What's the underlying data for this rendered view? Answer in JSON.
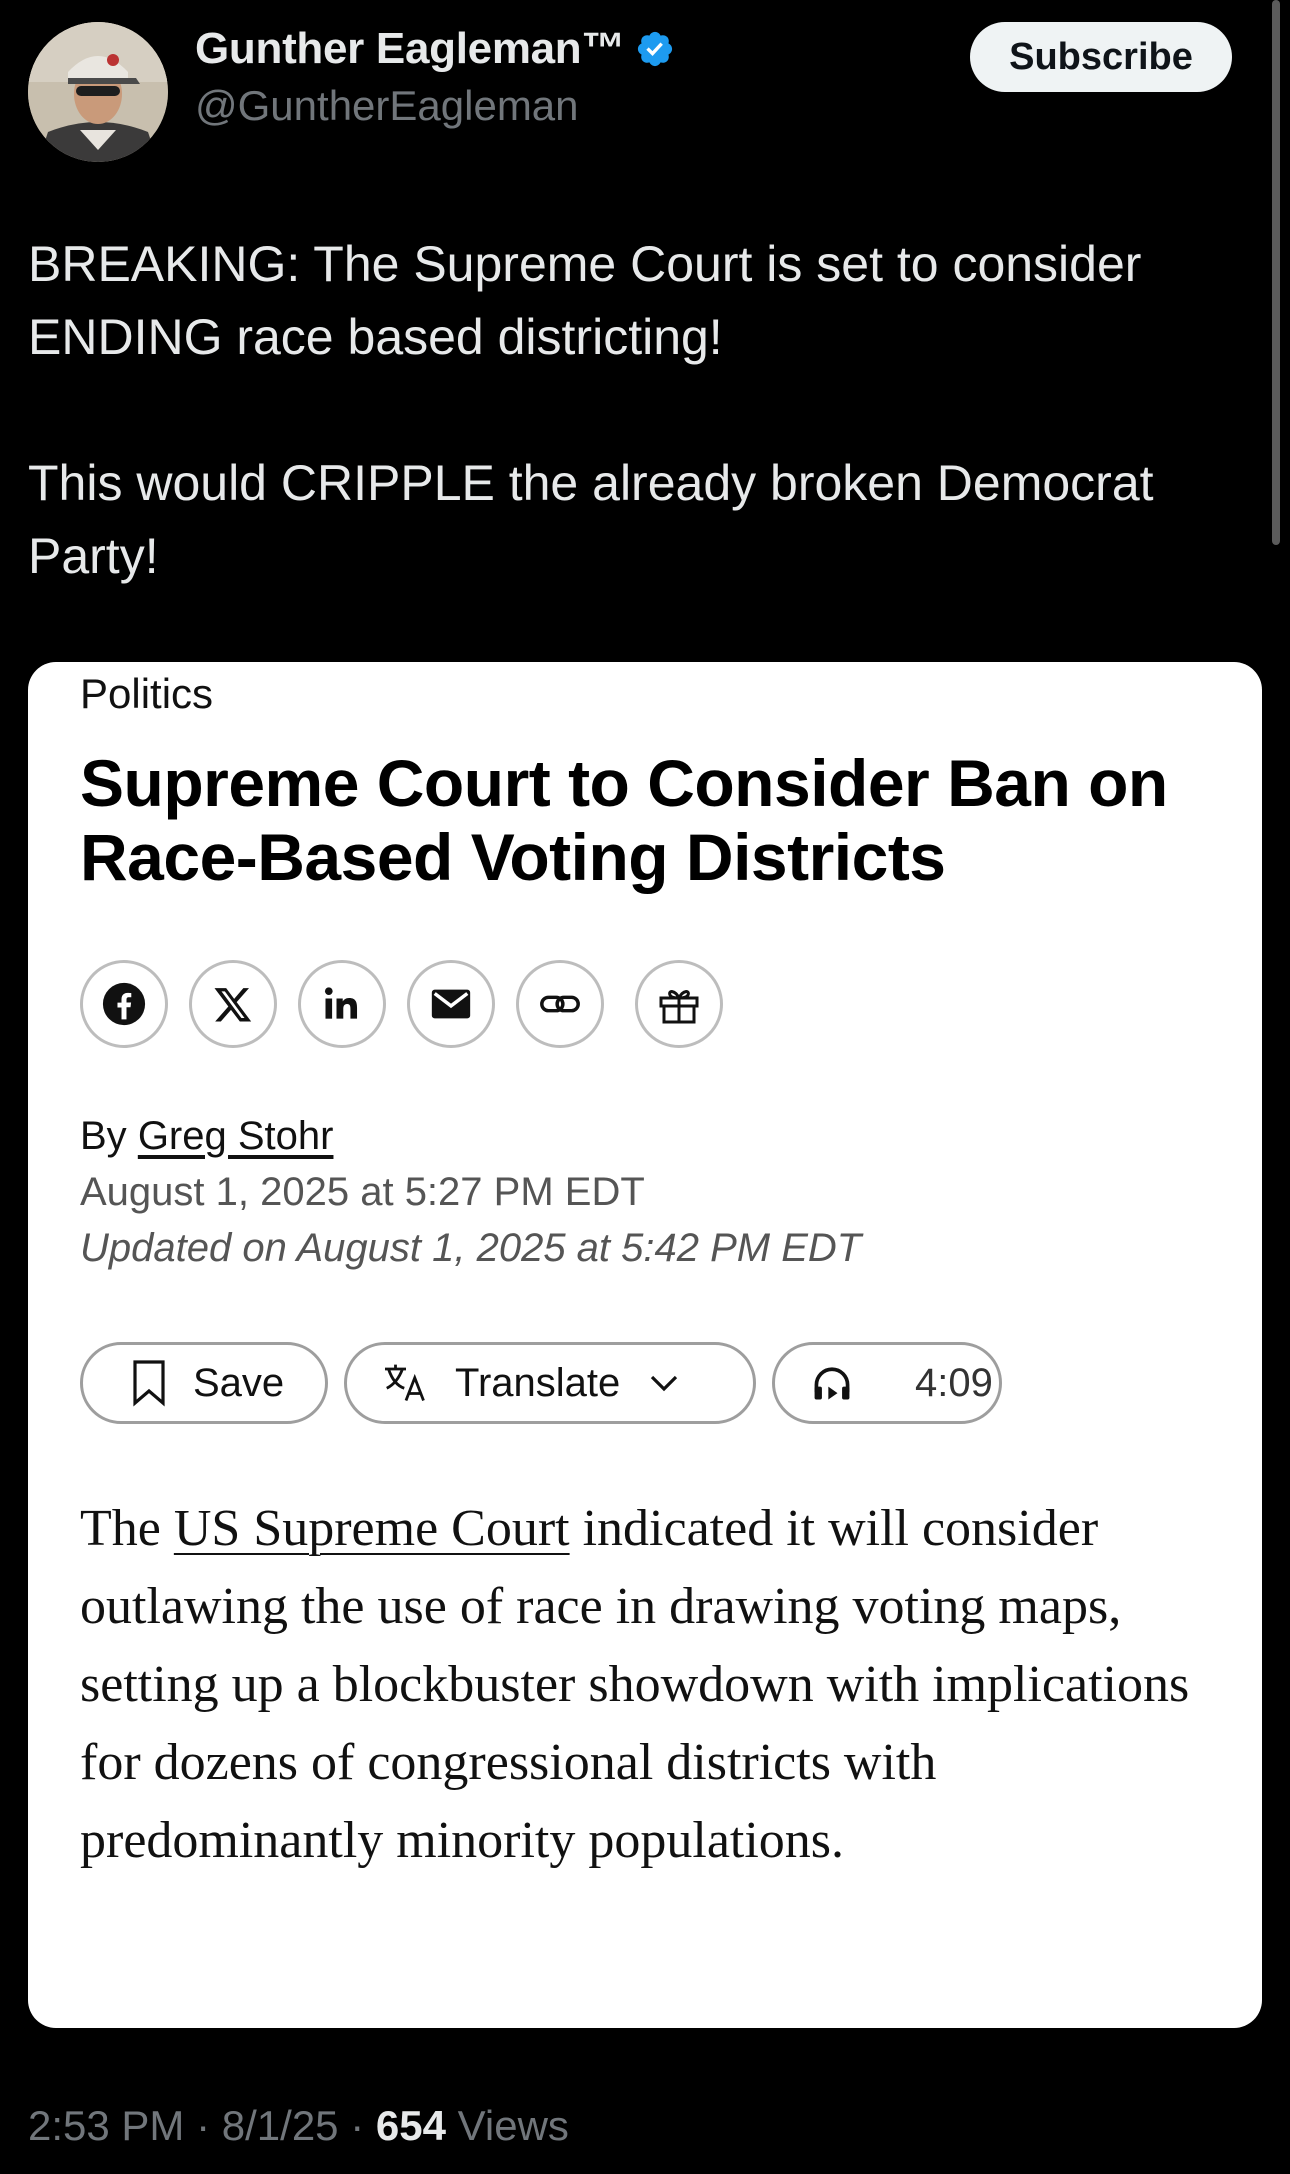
{
  "author": {
    "display_name": "Gunther Eagleman™",
    "handle": "@GuntherEagleman",
    "verified": true,
    "subscribe_label": "Subscribe"
  },
  "tweet": {
    "paragraphs": [
      "BREAKING: The Supreme Court is set to consider ENDING race based districting!",
      "This would CRIPPLE the already broken Democrat Party!"
    ]
  },
  "article": {
    "category": "Politics",
    "headline": "Supreme Court to Consider Ban on Race-Based Voting Districts",
    "share_icons": [
      "facebook-icon",
      "x-icon",
      "linkedin-icon",
      "email-icon",
      "link-icon",
      "gift-icon"
    ],
    "byline_prefix": "By",
    "author_name": "Greg Stohr",
    "published": "August 1, 2025 at 5:27 PM EDT",
    "updated": "Updated on August 1, 2025 at 5:42 PM EDT",
    "actions": {
      "save_label": "Save",
      "translate_label": "Translate",
      "audio_duration": "4:09"
    },
    "body_prefix": "The",
    "body_link": "US Supreme Court",
    "body_rest": "indicated it will consider outlawing the use of race in drawing voting maps, setting up a blockbuster showdown with implications for dozens of congressional districts with predominantly minority populations."
  },
  "meta": {
    "time": "2:53 PM",
    "date": "8/1/25",
    "separator": "·",
    "views_count": "654",
    "views_label": "Views"
  },
  "colors": {
    "background": "#000000",
    "text_primary": "#e7e9ea",
    "text_secondary": "#71767b",
    "verified_blue": "#1d9bf0",
    "card_background": "#ffffff"
  }
}
